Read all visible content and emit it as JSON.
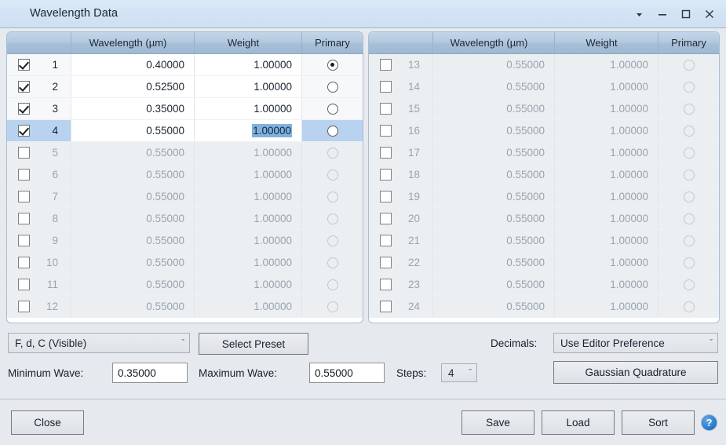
{
  "window": {
    "title": "Wavelength Data",
    "controls": [
      {
        "name": "dropdown-arrow",
        "glyph": "▼"
      },
      {
        "name": "minimize",
        "glyph": "—"
      },
      {
        "name": "maximize",
        "glyph": "□"
      },
      {
        "name": "close",
        "glyph": "✕"
      }
    ]
  },
  "tables": {
    "columns": [
      "",
      "Wavelength (µm)",
      "Weight",
      "Primary"
    ],
    "left_rows": [
      {
        "index": "1",
        "checked": true,
        "wavelength": "0.40000",
        "weight": "1.00000",
        "primary": true,
        "state": "enabled"
      },
      {
        "index": "2",
        "checked": true,
        "wavelength": "0.52500",
        "weight": "1.00000",
        "primary": false,
        "state": "enabled"
      },
      {
        "index": "3",
        "checked": true,
        "wavelength": "0.35000",
        "weight": "1.00000",
        "primary": false,
        "state": "enabled"
      },
      {
        "index": "4",
        "checked": true,
        "wavelength": "0.55000",
        "weight": "1.00000",
        "primary": false,
        "state": "selected"
      },
      {
        "index": "5",
        "checked": false,
        "wavelength": "0.55000",
        "weight": "1.00000",
        "primary": false,
        "state": "disabled"
      },
      {
        "index": "6",
        "checked": false,
        "wavelength": "0.55000",
        "weight": "1.00000",
        "primary": false,
        "state": "disabled"
      },
      {
        "index": "7",
        "checked": false,
        "wavelength": "0.55000",
        "weight": "1.00000",
        "primary": false,
        "state": "disabled"
      },
      {
        "index": "8",
        "checked": false,
        "wavelength": "0.55000",
        "weight": "1.00000",
        "primary": false,
        "state": "disabled"
      },
      {
        "index": "9",
        "checked": false,
        "wavelength": "0.55000",
        "weight": "1.00000",
        "primary": false,
        "state": "disabled"
      },
      {
        "index": "10",
        "checked": false,
        "wavelength": "0.55000",
        "weight": "1.00000",
        "primary": false,
        "state": "disabled"
      },
      {
        "index": "11",
        "checked": false,
        "wavelength": "0.55000",
        "weight": "1.00000",
        "primary": false,
        "state": "disabled"
      },
      {
        "index": "12",
        "checked": false,
        "wavelength": "0.55000",
        "weight": "1.00000",
        "primary": false,
        "state": "disabled"
      }
    ],
    "right_rows": [
      {
        "index": "13",
        "checked": false,
        "wavelength": "0.55000",
        "weight": "1.00000",
        "primary": false,
        "state": "disabled"
      },
      {
        "index": "14",
        "checked": false,
        "wavelength": "0.55000",
        "weight": "1.00000",
        "primary": false,
        "state": "disabled"
      },
      {
        "index": "15",
        "checked": false,
        "wavelength": "0.55000",
        "weight": "1.00000",
        "primary": false,
        "state": "disabled"
      },
      {
        "index": "16",
        "checked": false,
        "wavelength": "0.55000",
        "weight": "1.00000",
        "primary": false,
        "state": "disabled"
      },
      {
        "index": "17",
        "checked": false,
        "wavelength": "0.55000",
        "weight": "1.00000",
        "primary": false,
        "state": "disabled"
      },
      {
        "index": "18",
        "checked": false,
        "wavelength": "0.55000",
        "weight": "1.00000",
        "primary": false,
        "state": "disabled"
      },
      {
        "index": "19",
        "checked": false,
        "wavelength": "0.55000",
        "weight": "1.00000",
        "primary": false,
        "state": "disabled"
      },
      {
        "index": "20",
        "checked": false,
        "wavelength": "0.55000",
        "weight": "1.00000",
        "primary": false,
        "state": "disabled"
      },
      {
        "index": "21",
        "checked": false,
        "wavelength": "0.55000",
        "weight": "1.00000",
        "primary": false,
        "state": "disabled"
      },
      {
        "index": "22",
        "checked": false,
        "wavelength": "0.55000",
        "weight": "1.00000",
        "primary": false,
        "state": "disabled"
      },
      {
        "index": "23",
        "checked": false,
        "wavelength": "0.55000",
        "weight": "1.00000",
        "primary": false,
        "state": "disabled"
      },
      {
        "index": "24",
        "checked": false,
        "wavelength": "0.55000",
        "weight": "1.00000",
        "primary": false,
        "state": "disabled"
      }
    ],
    "selected_cell_text": "1.00000"
  },
  "controls": {
    "preset_combo_value": "F, d, C (Visible)",
    "select_preset_label": "Select Preset",
    "minimum_wave_label": "Minimum Wave:",
    "minimum_wave_value": "0.35000",
    "maximum_wave_label": "Maximum Wave:",
    "maximum_wave_value": "0.55000",
    "steps_label": "Steps:",
    "steps_value": "4",
    "decimals_label": "Decimals:",
    "decimals_value": "Use Editor Preference",
    "gaussian_quadrature_label": "Gaussian Quadrature",
    "caret_glyph": "ˇ"
  },
  "footer": {
    "close_label": "Close",
    "save_label": "Save",
    "load_label": "Load",
    "sort_label": "Sort",
    "help_glyph": "?"
  },
  "colors": {
    "titlebar": "#d3e2f4",
    "selection": "#b8d2ef",
    "text_selection": "#7fb2e0",
    "header": "#a8c0d8",
    "help_blue": "#2b7fd0"
  }
}
